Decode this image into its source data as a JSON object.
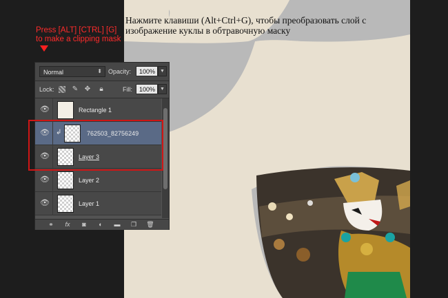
{
  "caption": "Нажмите клавиши (Alt+Ctrl+G), чтобы преобразовать слой с изображение куклы в обтравочную маску",
  "annotation": "Press [ALT] [CTRL] [G] to make a clipping mask",
  "colors": {
    "annotation": "#ff2b2b",
    "canvas_beige": "#e8e0d0",
    "canvas_gray": "#b7b7b7",
    "selected_layer": "#5a6a86"
  },
  "panel": {
    "blend_mode": "Normal",
    "opacity_label": "Opacity:",
    "opacity_value": "100%",
    "lock_label": "Lock:",
    "fill_label": "Fill:",
    "fill_value": "100%",
    "lock_icons": [
      "lock-transparent-icon",
      "lock-paint-icon",
      "lock-move-icon",
      "lock-all-icon"
    ],
    "layers": [
      {
        "name": "Rectangle 1",
        "visible": true,
        "selected": false
      },
      {
        "name": "762503_82756249",
        "visible": true,
        "selected": true,
        "clipped": true
      },
      {
        "name": "Layer 3",
        "visible": true,
        "selected": false
      },
      {
        "name": "Layer 2",
        "visible": true,
        "selected": false
      },
      {
        "name": "Layer 1",
        "visible": true,
        "selected": false
      }
    ],
    "footer_icons": [
      "link-icon",
      "fx-icon",
      "mask-icon",
      "adjustment-icon",
      "folder-icon",
      "new-layer-icon",
      "trash-icon"
    ],
    "fx_label": "fx"
  }
}
